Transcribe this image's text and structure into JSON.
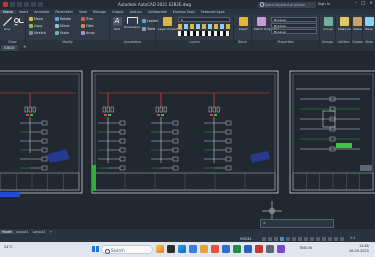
{
  "window": {
    "title": "Autodesk AutoCAD 2021   E2B2E.dwg",
    "search_placeholder": "Type a keyword or phrase",
    "sign_in": "Sign In"
  },
  "ribbon_tabs": [
    "Home",
    "Insert",
    "Annotate",
    "Parametric",
    "View",
    "Manage",
    "Output",
    "Add-ins",
    "Collaborate",
    "Express Tools",
    "Featured Apps"
  ],
  "ribbon": {
    "draw": {
      "title": "Draw",
      "line": "Line",
      "polyline": "Polyline",
      "circle": "Circle",
      "arc": "Arc"
    },
    "modify": {
      "title": "Modify",
      "tools": [
        "Move",
        "Rotate",
        "Trim",
        "Copy",
        "Mirror",
        "Fillet",
        "Stretch",
        "Scale",
        "Array"
      ]
    },
    "annotation": {
      "title": "Annotation",
      "text": "Text",
      "dimension": "Dimension",
      "leader": "Leader",
      "table": "Table"
    },
    "layers": {
      "title": "Layers",
      "layer_properties": "Layer Properties",
      "current_layer": "0"
    },
    "block": {
      "title": "Block",
      "insert": "Insert"
    },
    "properties": {
      "title": "Properties",
      "match": "Match Properties",
      "color": "ByLayer",
      "linetype": "ByLayer",
      "lineweight": "ByLayer"
    },
    "groups": {
      "title": "Groups",
      "group": "Group"
    },
    "utilities": {
      "title": "Utilities",
      "measure": "Measure"
    },
    "clipboard": {
      "title": "Clipboard",
      "paste": "Paste"
    },
    "view": {
      "title": "View",
      "base": "Base"
    }
  },
  "file_tab": {
    "name": "E2B2E",
    "new_tab": "+"
  },
  "command": {
    "placeholder": ""
  },
  "layout_tabs": [
    "Model",
    "Layout1",
    "Layout2"
  ],
  "status": {
    "model_label": "MODEL",
    "zoom": "1:1"
  },
  "taskbar": {
    "weather": "24°C",
    "search": "Search",
    "tray": "ENG  IN",
    "time": "12:48",
    "date": "26-05-2023"
  },
  "accent_colors": {
    "ribbon_bg": "#313a45",
    "viewport_bg": "#212830",
    "wire_red": "#e0423a",
    "wire_green": "#3fc24a",
    "highlight_blue": "#1f4fd1"
  }
}
